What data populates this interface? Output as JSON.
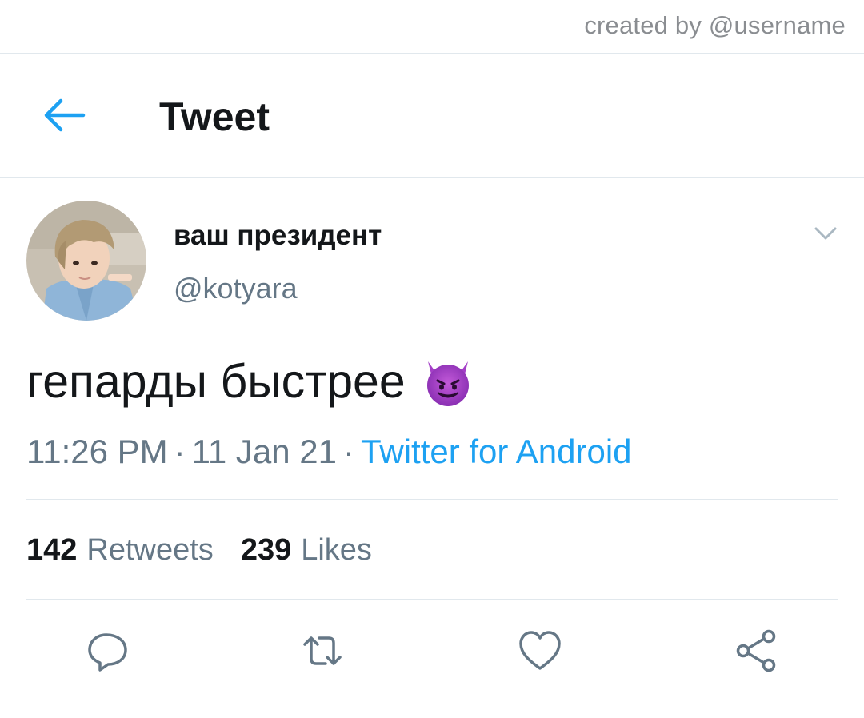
{
  "watermark": {
    "text": "created by @username"
  },
  "header": {
    "title": "Tweet",
    "back_icon": "arrow-left-icon"
  },
  "tweet": {
    "author": {
      "display_name": "ваш президент",
      "handle": "@kotyara"
    },
    "text": "гепарды быстрее",
    "emoji": "smiling-face-with-horns-emoji",
    "time": "11:26 PM",
    "date": "11 Jan 21",
    "separator": "·",
    "source": "Twitter for Android",
    "stats": {
      "retweets_count": "142",
      "retweets_label": "Retweets",
      "likes_count": "239",
      "likes_label": "Likes"
    }
  },
  "actions": [
    "reply-icon",
    "retweet-icon",
    "like-icon",
    "share-icon"
  ],
  "colors": {
    "accent": "#1da1f2",
    "secondary_text": "#657786",
    "divider": "#e1e8ed",
    "primary_text": "#14171a"
  }
}
